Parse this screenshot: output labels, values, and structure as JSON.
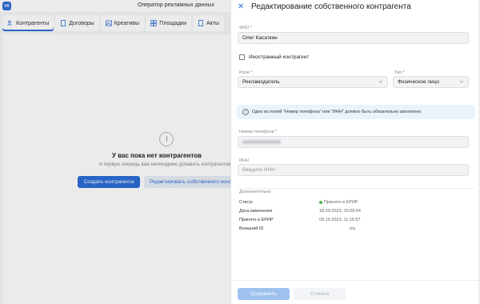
{
  "app": {
    "logo": "VK",
    "title": "Оператор рекламных данных",
    "tabs": [
      {
        "label": "Контрагенты",
        "icon": "people-icon"
      },
      {
        "label": "Договоры",
        "icon": "document-icon"
      },
      {
        "label": "Креативы",
        "icon": "image-icon"
      },
      {
        "label": "Площадки",
        "icon": "grid-icon"
      },
      {
        "label": "Акты",
        "icon": "document-icon"
      }
    ],
    "empty_state": {
      "title": "У вас пока нет контрагентов",
      "subtitle": "В первую очередь вам необходимо добавить контрагентов",
      "create_button": "Создать контрагента",
      "edit_own_button": "Редактировать собственного контрагента"
    }
  },
  "drawer": {
    "title": "Редактирование собственного контрагента",
    "fio": {
      "label": "ФИО *",
      "value": "Олег Касаткин"
    },
    "foreign": {
      "label": "Иностранный контрагент",
      "checked": false
    },
    "roles": {
      "label": "Роли *",
      "value": "Рекламодатель"
    },
    "type": {
      "label": "Тип *",
      "value": "Физическое лицо"
    },
    "info_text": "Одно из полей \"Номер телефона\" или \"ИНН\" должно быть обязательно заполнено",
    "phone": {
      "label": "Номер телефона *"
    },
    "inn": {
      "label": "ИНН",
      "placeholder": "Введите ИНН"
    },
    "extra": {
      "section_label": "Дополнительно",
      "status_key": "Статус",
      "status_value": "Принято в ЕРИР",
      "status_color": "#4bb34b",
      "changed_key": "Дата изменения",
      "changed_value": "18.09.2023, 10:58:04",
      "accepted_key": "Принято в ЕРИР",
      "accepted_value": "09.10.2023, 11:16:57",
      "external_id_key": "Внешний ID",
      "external_id_value": "my"
    },
    "save_label": "Сохранить",
    "cancel_label": "Отмена"
  },
  "colors": {
    "accent": "#2c6dd6",
    "info_bg": "#eaf2fc"
  }
}
